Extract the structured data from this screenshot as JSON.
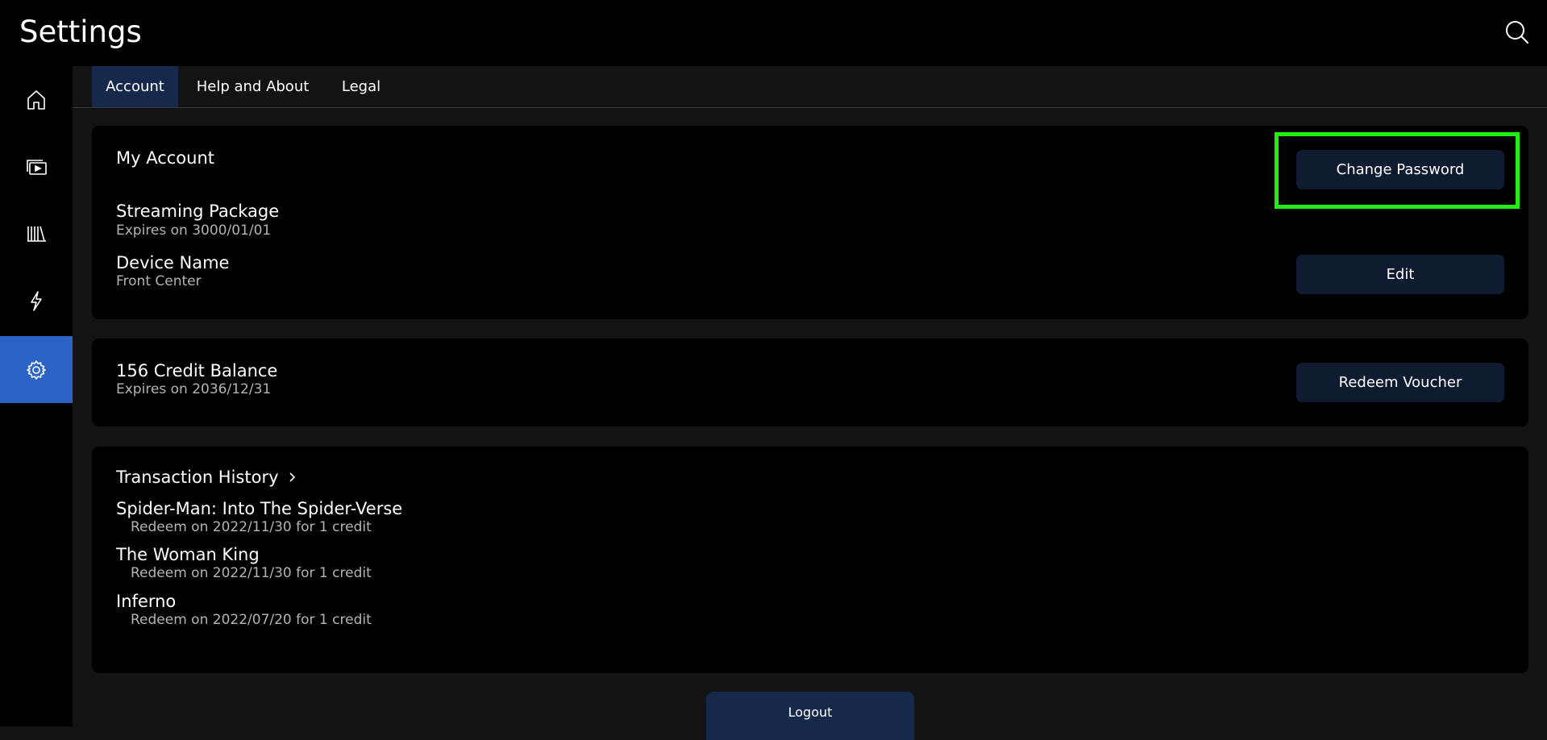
{
  "header": {
    "title": "Settings",
    "search_icon": "search-icon"
  },
  "sidebar": {
    "items": [
      {
        "icon": "home-icon"
      },
      {
        "icon": "movies-icon"
      },
      {
        "icon": "library-icon"
      },
      {
        "icon": "lightning-icon"
      },
      {
        "icon": "gear-icon",
        "active": true
      }
    ],
    "active_color": "#2a62c6"
  },
  "tabs": [
    {
      "label": "Account",
      "active": true
    },
    {
      "label": "Help and About"
    },
    {
      "label": "Legal"
    }
  ],
  "account": {
    "title": "My Account",
    "change_password_label": "Change Password",
    "streaming_package": {
      "title": "Streaming Package",
      "subtitle": "Expires on 3000/01/01"
    },
    "device": {
      "title": "Device Name",
      "subtitle": "Front Center",
      "edit_label": "Edit"
    }
  },
  "credits": {
    "title": "156 Credit Balance",
    "subtitle": "Expires on 2036/12/31",
    "redeem_label": "Redeem Voucher"
  },
  "transactions": {
    "title": "Transaction History",
    "items": [
      {
        "title": "Spider-Man: Into The Spider-Verse",
        "detail": "Redeem on 2022/11/30 for 1 credit"
      },
      {
        "title": "The Woman King",
        "detail": "Redeem on 2022/11/30 for 1 credit"
      },
      {
        "title": "Inferno",
        "detail": "Redeem on 2022/07/20 for 1 credit"
      }
    ]
  },
  "logout_label": "Logout",
  "colors": {
    "background": "#131313",
    "panel": "#000000",
    "button": "#0f1b31",
    "tab_active": "#16294a",
    "highlight": "#22ee11"
  }
}
